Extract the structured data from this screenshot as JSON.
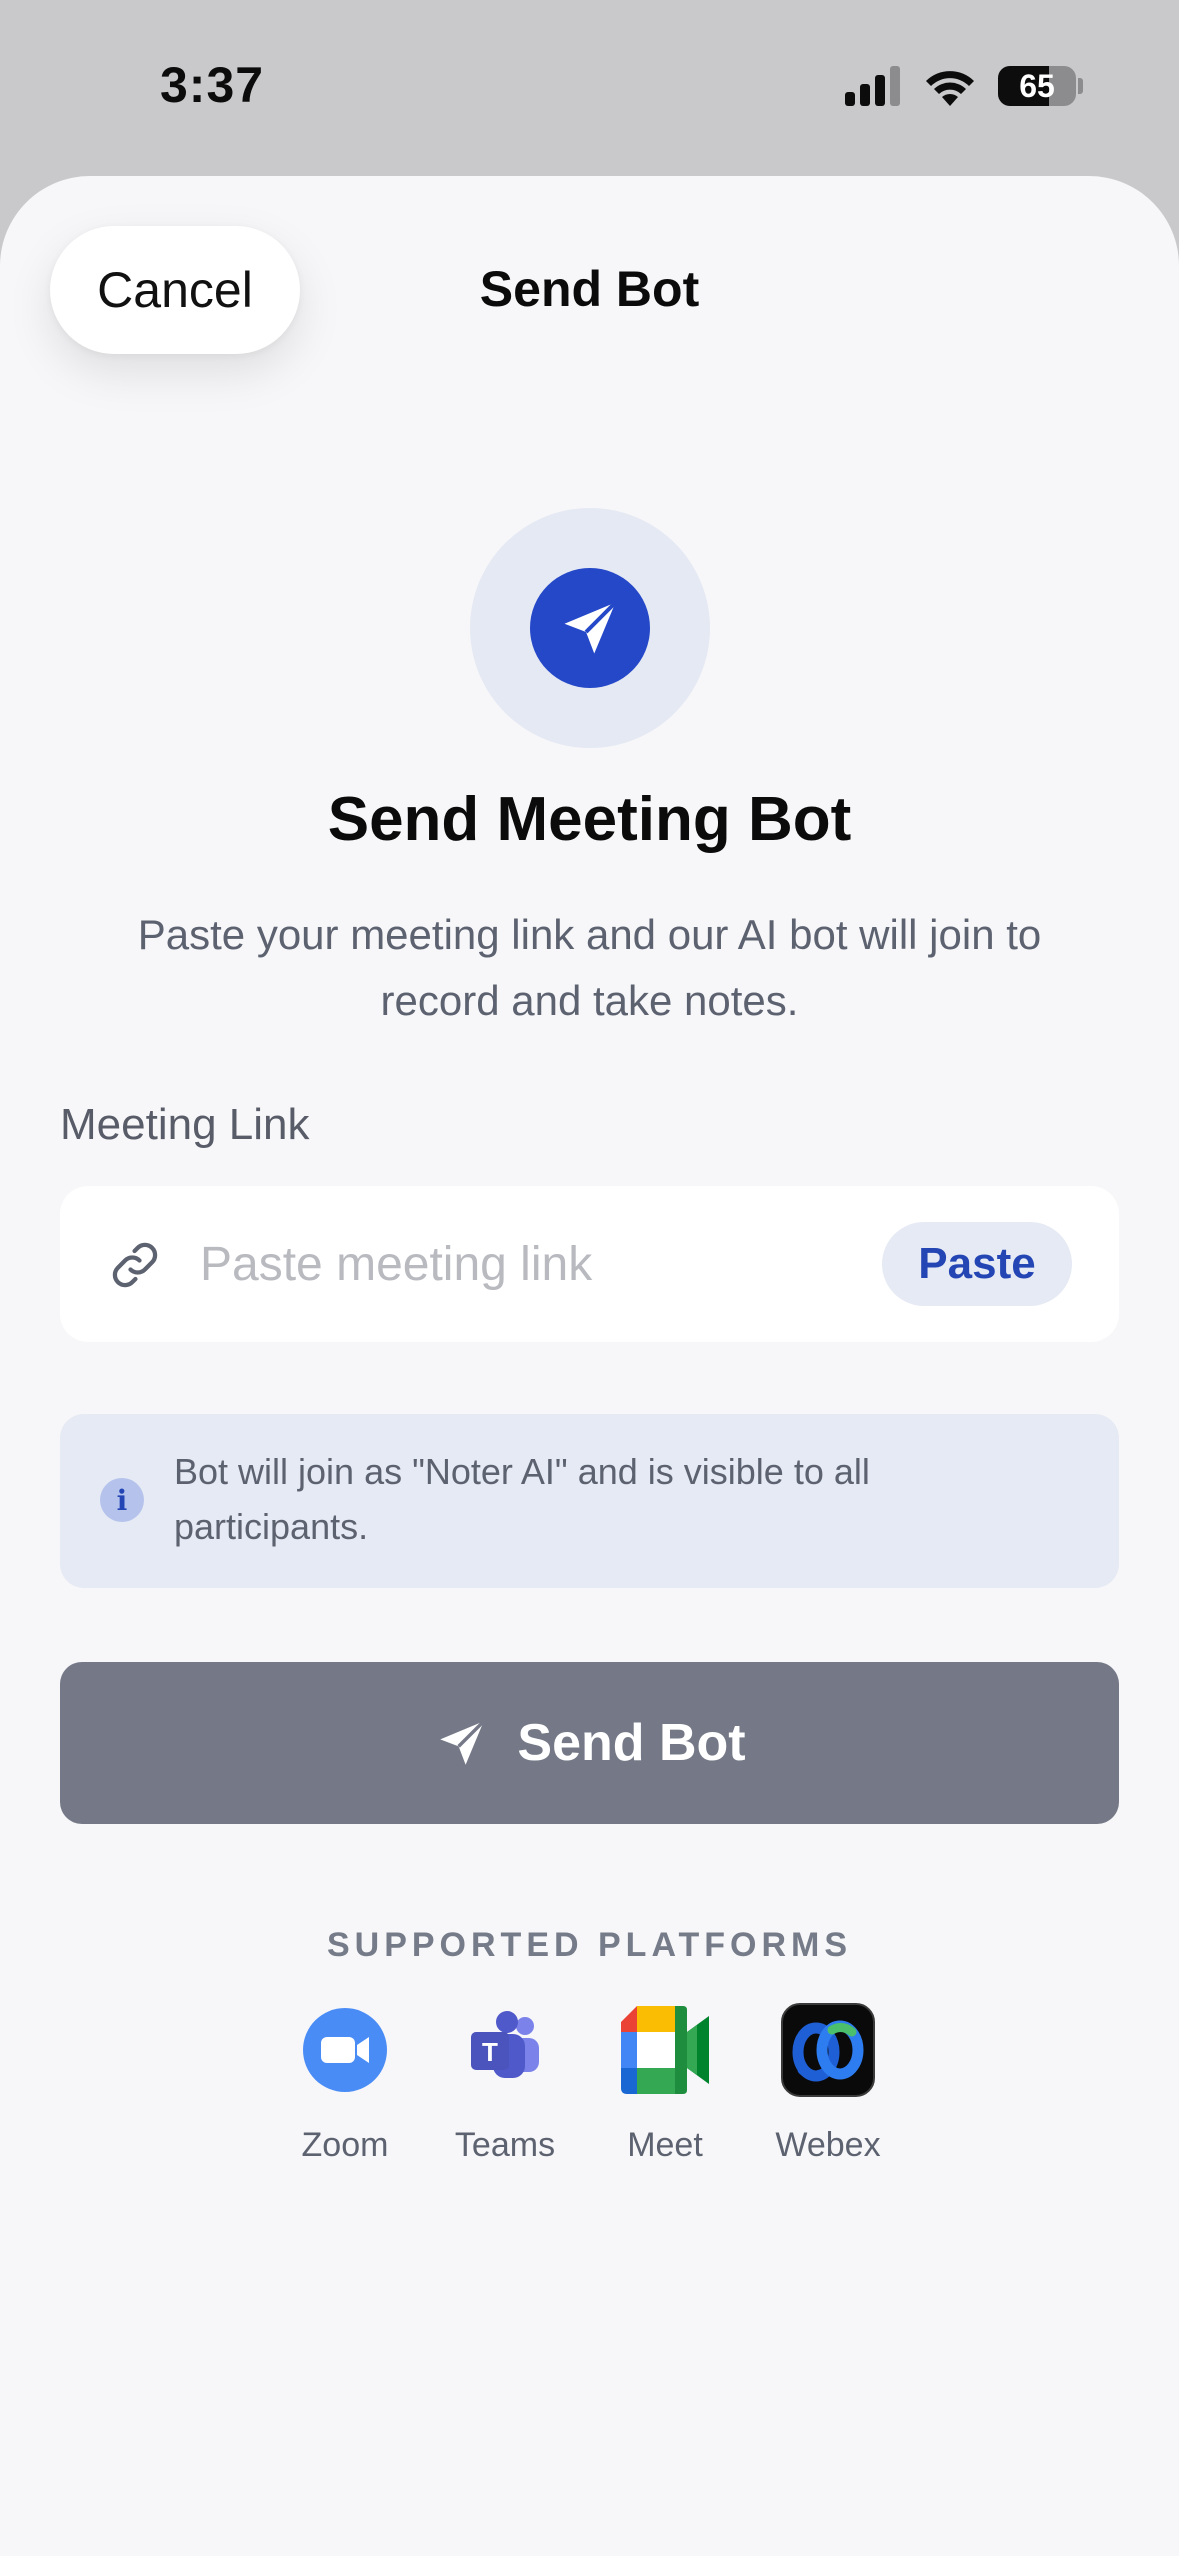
{
  "status_bar": {
    "time": "3:37",
    "battery_level": "65",
    "battery_fraction": 0.65
  },
  "nav": {
    "cancel_label": "Cancel",
    "title": "Send Bot"
  },
  "hero": {
    "title": "Send Meeting Bot",
    "subtitle": "Paste your meeting link and our AI bot will join to record and take notes.",
    "icon": "paper-plane-icon"
  },
  "link_field": {
    "label": "Meeting Link",
    "placeholder": "Paste meeting link",
    "value": "",
    "paste_label": "Paste",
    "icon": "link-icon"
  },
  "info": {
    "icon": "info-icon",
    "text": "Bot will join as \"Noter AI\" and is visible to all participants."
  },
  "send_button": {
    "label": "Send Bot",
    "icon": "paper-plane-icon",
    "color": "#757987"
  },
  "platforms": {
    "heading": "SUPPORTED PLATFORMS",
    "items": [
      {
        "name": "Zoom",
        "icon": "zoom-icon"
      },
      {
        "name": "Teams",
        "icon": "teams-icon"
      },
      {
        "name": "Meet",
        "icon": "google-meet-icon"
      },
      {
        "name": "Webex",
        "icon": "webex-icon"
      }
    ]
  },
  "colors": {
    "accent": "#2448c8",
    "sheet_background": "#f7f7f9",
    "info_background": "#e6eaf4"
  }
}
